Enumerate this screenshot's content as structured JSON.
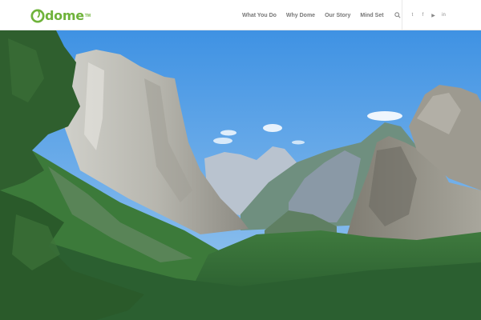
{
  "header": {
    "logo_text": "dome",
    "logo_tm": "TM",
    "brand_color": "#6fb33b"
  },
  "nav": {
    "items": [
      {
        "label": "What You Do"
      },
      {
        "label": "Why Dome"
      },
      {
        "label": "Our Story"
      },
      {
        "label": "Mind Set"
      }
    ],
    "search_icon": "search-icon"
  },
  "social": [
    {
      "name": "twitter-icon",
      "glyph": "t"
    },
    {
      "name": "facebook-icon",
      "glyph": "f"
    },
    {
      "name": "youtube-icon",
      "glyph": "▶"
    },
    {
      "name": "linkedin-icon",
      "glyph": "in"
    }
  ],
  "hero": {
    "image": "yosemite-valley-landscape",
    "sky_color": "#4a9be6",
    "forest_color": "#2f6a34"
  }
}
